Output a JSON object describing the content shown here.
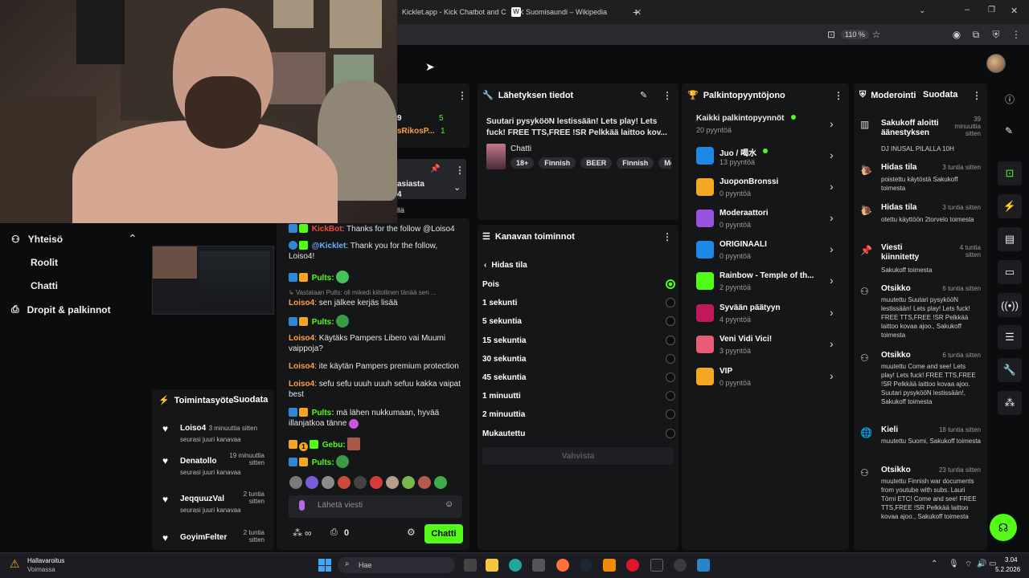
{
  "browser": {
    "tabs": [
      {
        "label": "Kicklet.app - Kick Chatbot and C"
      },
      {
        "label": "Suomisaundi – Wikipedia"
      }
    ],
    "zoom": "110 %"
  },
  "sidebar": {
    "section": "Yhteisö",
    "items": [
      {
        "label": "Roolit"
      },
      {
        "label": "Chatti"
      },
      {
        "label": "Dropit & palkinnot"
      }
    ]
  },
  "stats_partial": {
    "row1_left": "9",
    "row1_right": "5",
    "row2_left": "sRikosP...",
    "row2_right": "1"
  },
  "pinned_partial": {
    "line1": "asiasta",
    "line2": "4",
    "line3": "llä"
  },
  "activity": {
    "title": "Toimintasyöte",
    "filter": "Suodata",
    "items": [
      {
        "name": "Loiso4",
        "time": "3 minuuttia sitten",
        "sub": "seurasi juuri kanavaa"
      },
      {
        "name": "Denatollo",
        "time": "19 minuuttia sitten",
        "sub": "seurasi juuri kanavaa"
      },
      {
        "name": "JeqquuzVal",
        "time": "2 tuntia sitten",
        "sub": "seurasi juuri kanavaa"
      },
      {
        "name": "GoyimFelter",
        "time": "2 tuntia sitten",
        "sub": ""
      }
    ]
  },
  "chat": {
    "lines": [
      {
        "user": "KickBot",
        "text": ": Thanks for the follow @Loiso4"
      },
      {
        "user": "@Kicklet",
        "text": ": Thank you for the follow, Loiso4!"
      },
      {
        "user": "Pults:",
        "text": ""
      },
      {
        "user": "",
        "text": "Vastataan Pults: oli mikedi kiitollinen tänää sen ..."
      },
      {
        "user": "Loiso4",
        "text": ": sen jälkee kerjäs lisää"
      },
      {
        "user": "Pults:",
        "text": ""
      },
      {
        "user": "Loiso4",
        "text": ": Käytäks Pampers Libero vai Muumi vaippoja?"
      },
      {
        "user": "Loiso4",
        "text": ": ite käytän Pampers premium protection"
      },
      {
        "user": "Loiso4",
        "text": ": sefu sefu uuuh uuuh sefuu kakka vaipat best"
      },
      {
        "user": "Pults:",
        "text": " mä lähen nukkumaan, hyvää illanjatkoa tänne"
      },
      {
        "user": "Gebu:",
        "text": ""
      },
      {
        "user": "Pults:",
        "text": ""
      }
    ],
    "badge_number": "1",
    "input_placeholder": "Lähetä viesti",
    "points": "0",
    "send_label": "Chatti"
  },
  "stream_info": {
    "title": "Lähetyksen tiedot",
    "stream_title": "Suutari pysykööN lestissään! Lets play! Lets fuck! FREE TTS,FREE !SR Pelkkää laittoo kov...",
    "category": "Chatti",
    "tags": [
      "18+",
      "Finnish",
      "BEER",
      "Finnish",
      "Me"
    ]
  },
  "channel_actions": {
    "title": "Kanavan toiminnot",
    "back_label": "Hidas tila",
    "options": [
      {
        "label": "Pois",
        "selected": true
      },
      {
        "label": "1 sekunti",
        "selected": false
      },
      {
        "label": "5 sekuntia",
        "selected": false
      },
      {
        "label": "15 sekuntia",
        "selected": false
      },
      {
        "label": "30 sekuntia",
        "selected": false
      },
      {
        "label": "45 sekuntia",
        "selected": false
      },
      {
        "label": "1 minuutti",
        "selected": false
      },
      {
        "label": "2 minuuttia",
        "selected": false
      },
      {
        "label": "Mukautettu",
        "selected": false
      }
    ],
    "confirm_label": "Vahvista"
  },
  "rewards": {
    "title": "Palkintopyyntöjono",
    "all_label": "Kaikki palkintopyynnöt",
    "all_count": "20 pyyntöä",
    "items": [
      {
        "name": "Juo / 喝水",
        "count": "13 pyyntöä",
        "color": "#1e88e5"
      },
      {
        "name": "JuoponBronssi",
        "count": "0 pyyntöä",
        "color": "#f5a623"
      },
      {
        "name": "Moderaattori",
        "count": "0 pyyntöä",
        "color": "#9b51e0"
      },
      {
        "name": "ORIGINAALI",
        "count": "0 pyyntöä",
        "color": "#1e88e5"
      },
      {
        "name": "Rainbow - Temple of th...",
        "count": "2 pyyntöä",
        "color": "#53fc18"
      },
      {
        "name": "Syvään päätyyn",
        "count": "4 pyyntöä",
        "color": "#c2185b"
      },
      {
        "name": "Veni Vidi Vici!",
        "count": "3 pyyntöä",
        "color": "#e85d75"
      },
      {
        "name": "VIP",
        "count": "0 pyyntöä",
        "color": "#f5a623"
      }
    ]
  },
  "moderation": {
    "title": "Moderointi",
    "filter": "Suodata",
    "items": [
      {
        "title": "Sakukoff aloitti äänestyksen",
        "time": "39 minuuttia sitten",
        "desc": "DJ INUSAL PILALLA 10H"
      },
      {
        "title": "Hidas tila",
        "time": "3 tuntia sitten",
        "desc": "poistettu käytöstä Sakukoff toimesta"
      },
      {
        "title": "Hidas tila",
        "time": "3 tuntia sitten",
        "desc": "otettu käyttöön 2torvelo toimesta"
      },
      {
        "title": "Viesti kiinnitetty",
        "time": "4 tuntia sitten",
        "desc": "Sakukoff toimesta"
      },
      {
        "title": "Otsikko",
        "time": "6 tuntia sitten",
        "desc": "muutettu Suutari pysykööN lestissään! Lets play! Lets fuck! FREE TTS,FREE !SR Pelkkää laittoo kovaa ajoo., Sakukoff toimesta"
      },
      {
        "title": "Otsikko",
        "time": "6 tuntia sitten",
        "desc": "muutettu Come and see! Lets play! Lets fuck! FREE TTS,FREE !SR Pelkkää laittoo kovaa ajoo. Suutari pysykööN lestissään!, Sakukoff toimesta"
      },
      {
        "title": "Kieli",
        "time": "18 tuntia sitten",
        "desc": "muutettu Suomi, Sakukoff toimesta"
      },
      {
        "title": "Otsikko",
        "time": "23 tuntia sitten",
        "desc": "muutettu Finnish war documents from youtube with subs. Lauri Törni ETC! Come and see! FREE TTS,FREE !SR Pelkkää laittoo kovaa ajoo., Sakukoff toimesta"
      }
    ]
  },
  "taskbar": {
    "weather_title": "Hallavaroitus",
    "weather_sub": "Voimassa",
    "search": "Hae",
    "time": "3.04",
    "date": "5.2.2026"
  }
}
